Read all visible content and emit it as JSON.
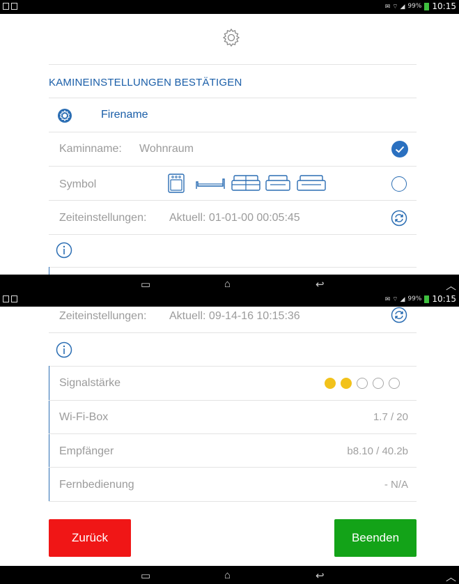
{
  "status_bar": {
    "signal_small": "99%",
    "time": "10:15"
  },
  "screen1": {
    "section_title": "KAMINEINSTELLUNGEN BESTÄTIGEN",
    "fire_name": "Firename",
    "fireplace_name_label": "Kaminname:",
    "fireplace_name_value": "Wohnraum",
    "symbol_label": "Symbol",
    "time_label": "Zeiteinstellungen:",
    "time_value": "Aktuell: 01-01-00 00:05:45"
  },
  "screen2": {
    "time_label": "Zeiteinstellungen:",
    "time_value": "Aktuell: 09-14-16 10:15:36",
    "signal_label": "Signalstärke",
    "signal_strength": {
      "filled": 2,
      "total": 5,
      "color_on": "#f2c21b"
    },
    "wifi_label": "Wi-Fi-Box",
    "wifi_value": "1.7 / 20",
    "receiver_label": "Empfänger",
    "receiver_value": "b8.10 / 40.2b",
    "remote_label": "Fernbedienung",
    "remote_value": "- N/A",
    "back_button": "Zurück",
    "finish_button": "Beenden"
  },
  "colors": {
    "accent": "#1a5ea8",
    "back": "#f01616",
    "finish": "#13a318"
  },
  "icons": [
    "gear-icon",
    "settings-icon",
    "check-icon",
    "sync-icon",
    "info-icon",
    "stove-icon",
    "bench-icon",
    "sofa-icon"
  ]
}
